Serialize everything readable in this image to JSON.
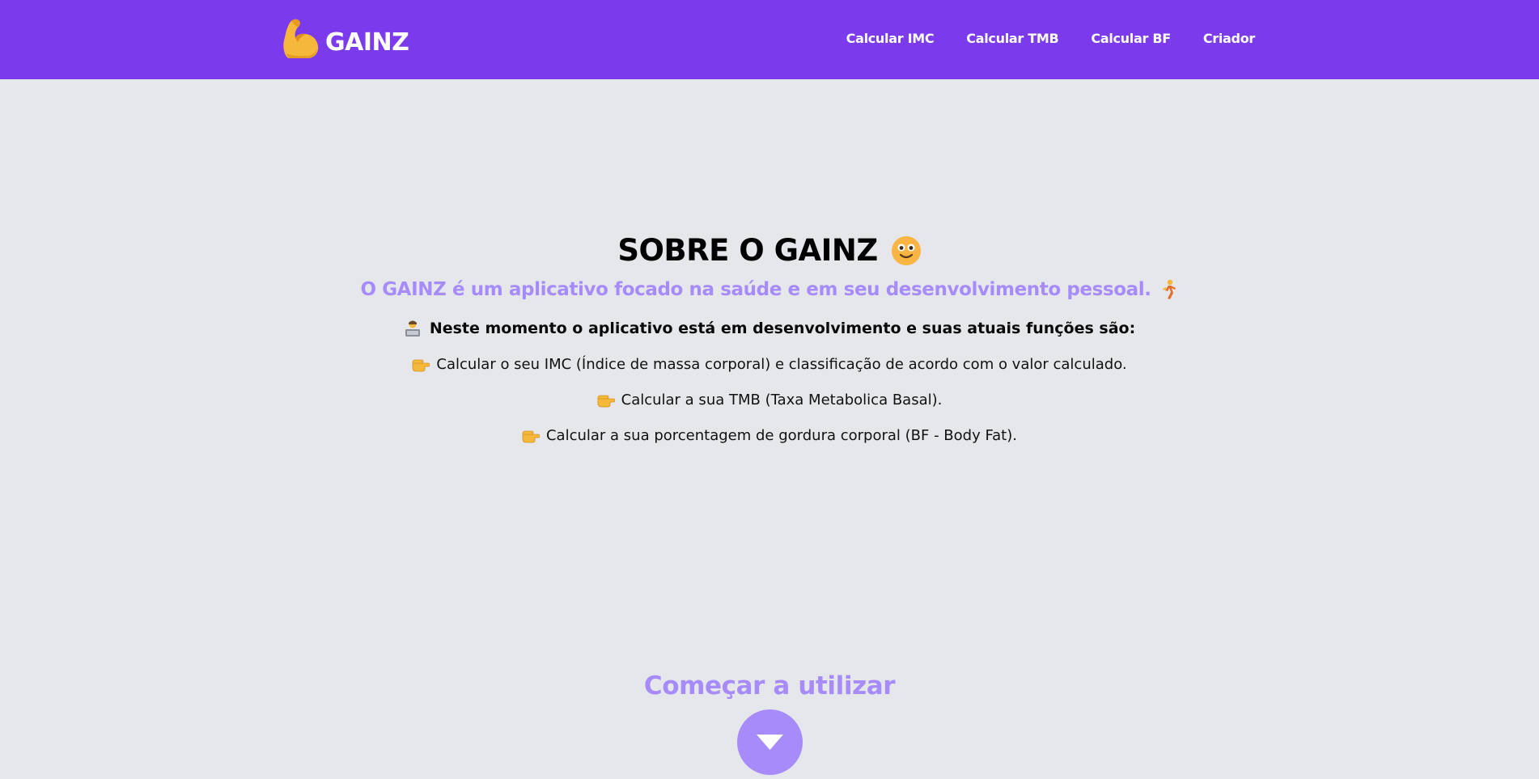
{
  "header": {
    "brand": "GAINZ",
    "brand_icon": "flexed-biceps-icon",
    "nav": [
      {
        "label": "Calcular IMC"
      },
      {
        "label": "Calcular TMB"
      },
      {
        "label": "Calcular BF"
      },
      {
        "label": "Criador"
      }
    ]
  },
  "main": {
    "title": "SOBRE O GAINZ",
    "title_icon": "smiling-face-icon",
    "subtitle": "O GAINZ é um aplicativo focado na saúde e em seu desenvolvimento pessoal.",
    "subtitle_icon": "running-person-icon",
    "status": "Neste momento o aplicativo está em desenvolvimento e suas atuais funções são:",
    "status_icon": "technologist-icon",
    "features": [
      "Calcular o seu IMC (Índice de massa corporal) e classificação de acordo com o valor calculado.",
      "Calcular a sua TMB (Taxa Metabolica Basal).",
      "Calcular a sua porcentagem de gordura corporal (BF - Body Fat)."
    ],
    "feature_icon": "pointing-hand-icon",
    "cta_label": "Começar a utilizar",
    "cta_icon": "triangle-down-icon"
  },
  "colors": {
    "header_bg": "#7c3aed",
    "page_bg": "#e5e7eb",
    "accent": "#a78bfa"
  }
}
